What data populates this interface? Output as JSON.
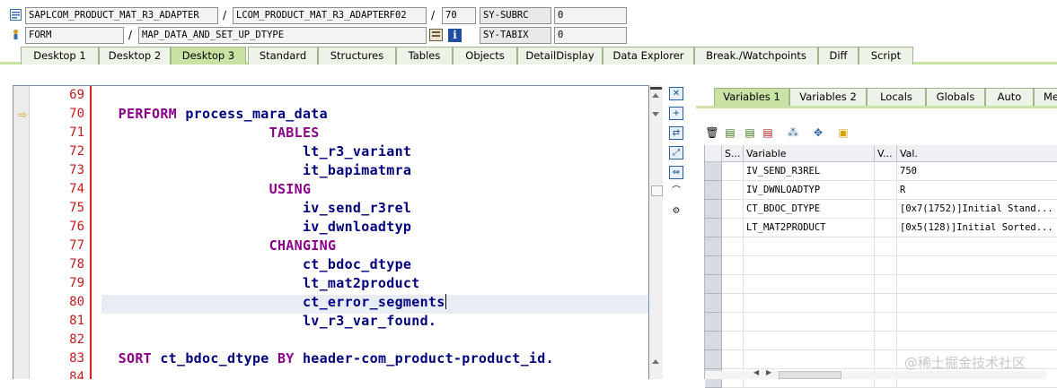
{
  "info_row1": {
    "program": "SAPLCOM_PRODUCT_MAT_R3_ADAPTER",
    "include": "LCOM_PRODUCT_MAT_R3_ADAPTERF02",
    "line": "70",
    "sysfield": "SY-SUBRC",
    "sysvalue": "0"
  },
  "info_row2": {
    "event_type": "FORM",
    "event_name": "MAP_DATA_AND_SET_UP_DTYPE",
    "sysfield": "SY-TABIX",
    "sysvalue": "0"
  },
  "tabs": [
    "Desktop 1",
    "Desktop 2",
    "Desktop 3",
    "Standard",
    "Structures",
    "Tables",
    "Objects",
    "DetailDisplay",
    "Data Explorer",
    "Break./Watchpoints",
    "Diff",
    "Script"
  ],
  "active_tab": "Desktop 3",
  "code_lines": [
    {
      "num": "69",
      "parts": []
    },
    {
      "num": "70",
      "parts": [
        {
          "t": "  "
        },
        {
          "k": "PERFORM"
        },
        {
          "t": " process_mara_data"
        }
      ]
    },
    {
      "num": "71",
      "parts": [
        {
          "t": "                    "
        },
        {
          "k": "TABLES"
        }
      ]
    },
    {
      "num": "72",
      "parts": [
        {
          "t": "                        lt_r3_variant"
        }
      ]
    },
    {
      "num": "73",
      "parts": [
        {
          "t": "                        it_bapimatmra"
        }
      ]
    },
    {
      "num": "74",
      "parts": [
        {
          "t": "                    "
        },
        {
          "k": "USING"
        }
      ]
    },
    {
      "num": "75",
      "parts": [
        {
          "t": "                        iv_send_r3rel"
        }
      ]
    },
    {
      "num": "76",
      "parts": [
        {
          "t": "                        iv_dwnloadtyp"
        }
      ]
    },
    {
      "num": "77",
      "parts": [
        {
          "t": "                    "
        },
        {
          "k": "CHANGING"
        }
      ]
    },
    {
      "num": "78",
      "parts": [
        {
          "t": "                        ct_bdoc_dtype"
        }
      ]
    },
    {
      "num": "79",
      "parts": [
        {
          "t": "                        lt_mat2product"
        }
      ]
    },
    {
      "num": "80",
      "parts": [
        {
          "t": "                        ct_error_segments"
        }
      ]
    },
    {
      "num": "81",
      "parts": [
        {
          "t": "                        lv_r3_var_found."
        }
      ]
    },
    {
      "num": "82",
      "parts": []
    },
    {
      "num": "83",
      "parts": [
        {
          "t": "  "
        },
        {
          "k": "SORT"
        },
        {
          "t": " ct_bdoc_dtype "
        },
        {
          "k": "BY"
        },
        {
          "t": " header-com_product-product_id."
        }
      ]
    },
    {
      "num": "84",
      "parts": []
    }
  ],
  "right_tabs": [
    "Variables 1",
    "Variables 2",
    "Locals",
    "Globals",
    "Auto",
    "Me"
  ],
  "right_active_tab": "Variables 1",
  "grid_headers": {
    "s": "S...",
    "variable": "Variable",
    "v": "V...",
    "val": "Val."
  },
  "variables": [
    {
      "name": "IV_SEND_R3REL",
      "value": "750"
    },
    {
      "name": "IV_DWNLOADTYP",
      "value": "R"
    },
    {
      "name": "CT_BDOC_DTYPE",
      "value": "[0x7(1752)]Initial Stand..."
    },
    {
      "name": "LT_MAT2PRODUCT",
      "value": "[0x5(128)]Initial Sorted..."
    }
  ],
  "watermark": "@稀土掘金技术社区",
  "colors": {
    "tab_active": "#c9e3a4",
    "keyword": "#8b008b",
    "identifier": "#00007f",
    "line_number": "#c41a1a"
  }
}
